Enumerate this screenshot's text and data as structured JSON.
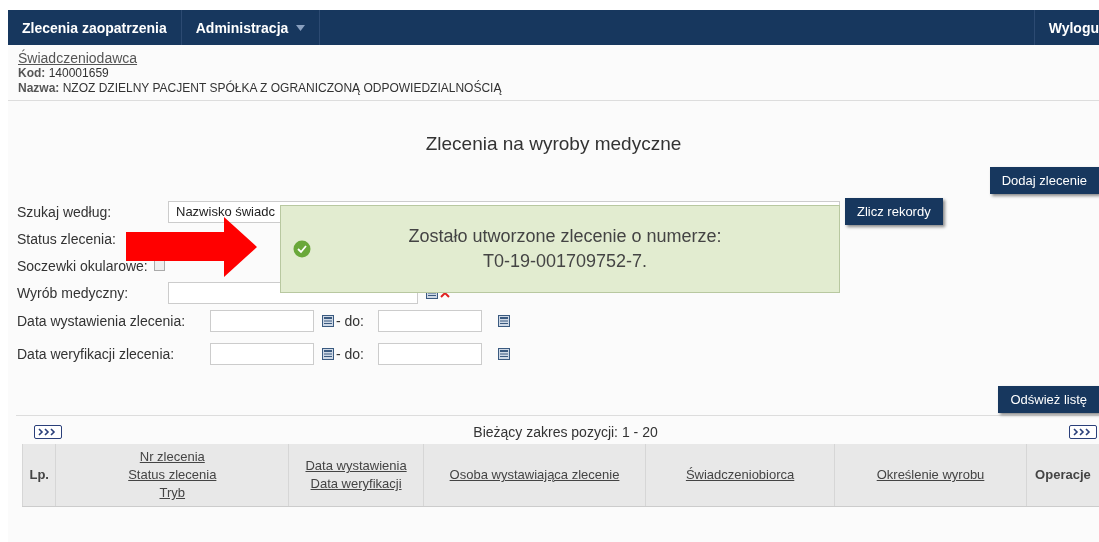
{
  "nav": {
    "items": [
      {
        "label": "Zlecenia zaopatrzenia",
        "dropdown": false
      },
      {
        "label": "Administracja",
        "dropdown": true
      }
    ],
    "logout": "Wylogu"
  },
  "provider": {
    "link": "Świadczeniodawca",
    "fields": [
      {
        "label": "Kod:",
        "value": "140001659"
      },
      {
        "label": "Nazwa:",
        "value": "NZOZ DZIELNY PACJENT SPÓŁKA Z OGRANICZONĄ ODPOWIEDZIALNOŚCIĄ"
      }
    ]
  },
  "title": "Zlecenia na wyroby medyczne",
  "add_button": "Dodaj zlecenie",
  "search": {
    "rows": [
      {
        "kind": "select",
        "label": "Szukaj według:",
        "value": "Nazwisko świadc"
      },
      {
        "kind": "blank",
        "label": "Status zlecenia:"
      },
      {
        "kind": "checkbox",
        "label": "Soczewki okularowe:",
        "checked": false
      },
      {
        "kind": "lookup",
        "label": "Wyrób medyczny:"
      },
      {
        "kind": "range",
        "label": "Data wystawienia zlecenia:",
        "separator": "- do:"
      },
      {
        "kind": "range",
        "label": "Data weryfikacji zlecenia:",
        "separator": "- do:"
      }
    ],
    "count_button": "Zlicz rekordy"
  },
  "refresh_button": "Odśwież listę",
  "pager": {
    "range": "Bieżący zakres pozycji: 1 - 20"
  },
  "table": {
    "columns": [
      {
        "labels": [
          "Lp."
        ],
        "sortable": false
      },
      {
        "labels": [
          "Nr zlecenia",
          "Status zlecenia",
          "Tryb"
        ],
        "sortable": true
      },
      {
        "labels": [
          "Data wystawienia",
          "Data weryfikacji"
        ],
        "sortable": true
      },
      {
        "labels": [
          "Osoba wystawiająca zlecenie"
        ],
        "sortable": true
      },
      {
        "labels": [
          "Świadczeniobiorca"
        ],
        "sortable": true
      },
      {
        "labels": [
          "Określenie wyrobu"
        ],
        "sortable": true
      },
      {
        "labels": [
          "Operacje"
        ],
        "sortable": false
      }
    ]
  },
  "toast": {
    "lines": [
      "Zostało utworzone zlecenie o numerze:",
      "T0-19-001709752-7."
    ]
  }
}
